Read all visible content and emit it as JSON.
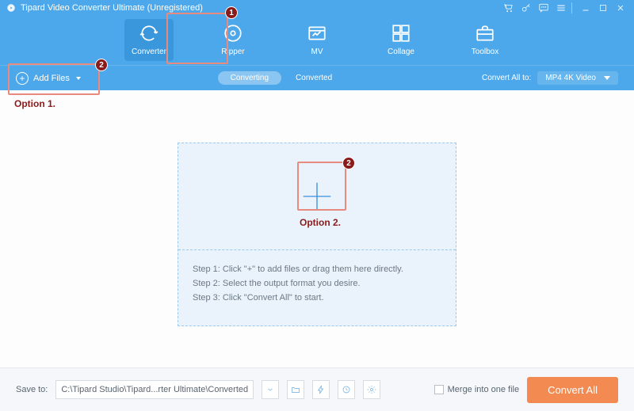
{
  "titlebar": {
    "title": "Tipard Video Converter Ultimate (Unregistered)"
  },
  "nav": {
    "items": [
      {
        "label": "Converter"
      },
      {
        "label": "Ripper"
      },
      {
        "label": "MV"
      },
      {
        "label": "Collage"
      },
      {
        "label": "Toolbox"
      }
    ]
  },
  "subbar": {
    "add_files": "Add Files",
    "tab_converting": "Converting",
    "tab_converted": "Converted",
    "convert_all_to": "Convert All to:",
    "format": "MP4 4K Video"
  },
  "annotations": {
    "option1": "Option 1.",
    "option2": "Option 2.",
    "b1": "1",
    "b2": "2",
    "b3": "2"
  },
  "dropzone": {
    "step1": "Step 1: Click \"+\" to add files or drag them here directly.",
    "step2": "Step 2: Select the output format you desire.",
    "step3": "Step 3: Click \"Convert All\" to start."
  },
  "bottom": {
    "save_to": "Save to:",
    "path": "C:\\Tipard Studio\\Tipard...rter Ultimate\\Converted",
    "merge": "Merge into one file",
    "convert_all": "Convert All"
  }
}
